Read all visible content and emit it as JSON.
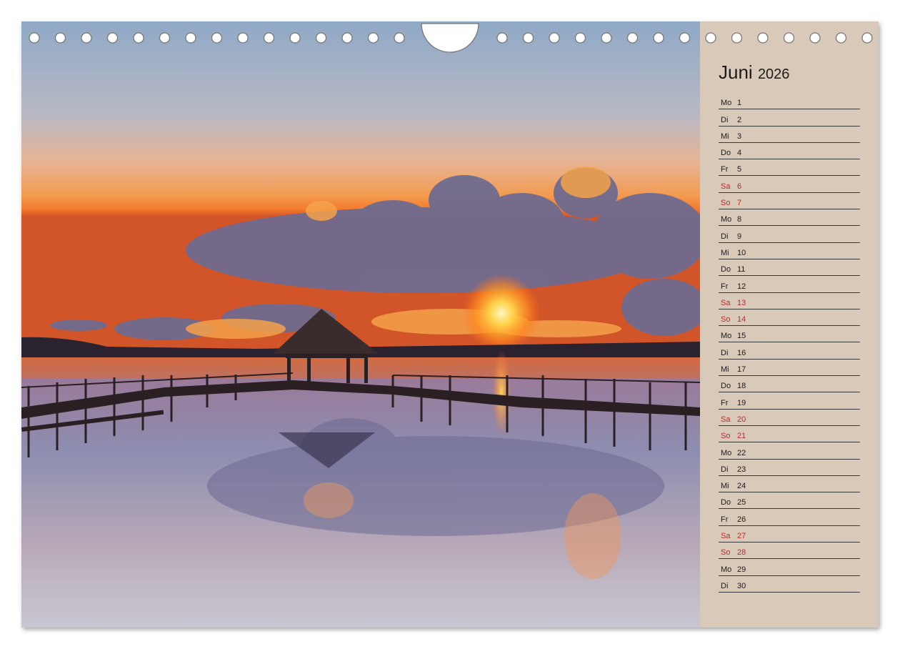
{
  "calendar": {
    "month": "Juni",
    "year": "2026",
    "days": [
      {
        "name": "Mo",
        "num": "1",
        "weekend": false
      },
      {
        "name": "Di",
        "num": "2",
        "weekend": false
      },
      {
        "name": "Mi",
        "num": "3",
        "weekend": false
      },
      {
        "name": "Do",
        "num": "4",
        "weekend": false
      },
      {
        "name": "Fr",
        "num": "5",
        "weekend": false
      },
      {
        "name": "Sa",
        "num": "6",
        "weekend": true
      },
      {
        "name": "So",
        "num": "7",
        "weekend": true
      },
      {
        "name": "Mo",
        "num": "8",
        "weekend": false
      },
      {
        "name": "Di",
        "num": "9",
        "weekend": false
      },
      {
        "name": "Mi",
        "num": "10",
        "weekend": false
      },
      {
        "name": "Do",
        "num": "11",
        "weekend": false
      },
      {
        "name": "Fr",
        "num": "12",
        "weekend": false
      },
      {
        "name": "Sa",
        "num": "13",
        "weekend": true
      },
      {
        "name": "So",
        "num": "14",
        "weekend": true
      },
      {
        "name": "Mo",
        "num": "15",
        "weekend": false
      },
      {
        "name": "Di",
        "num": "16",
        "weekend": false
      },
      {
        "name": "Mi",
        "num": "17",
        "weekend": false
      },
      {
        "name": "Do",
        "num": "18",
        "weekend": false
      },
      {
        "name": "Fr",
        "num": "19",
        "weekend": false
      },
      {
        "name": "Sa",
        "num": "20",
        "weekend": true
      },
      {
        "name": "So",
        "num": "21",
        "weekend": true
      },
      {
        "name": "Mo",
        "num": "22",
        "weekend": false
      },
      {
        "name": "Di",
        "num": "23",
        "weekend": false
      },
      {
        "name": "Mi",
        "num": "24",
        "weekend": false
      },
      {
        "name": "Do",
        "num": "25",
        "weekend": false
      },
      {
        "name": "Fr",
        "num": "26",
        "weekend": false
      },
      {
        "name": "Sa",
        "num": "27",
        "weekend": true
      },
      {
        "name": "So",
        "num": "28",
        "weekend": true
      },
      {
        "name": "Mo",
        "num": "29",
        "weekend": false
      },
      {
        "name": "Di",
        "num": "30",
        "weekend": false
      }
    ]
  },
  "colors": {
    "panel_bg": "#d9c9b9",
    "weekend_text": "#c0282c",
    "weekday_text": "#1b1b1b"
  },
  "photo": {
    "subject": "sunset-over-lake-with-pier-and-pavilion"
  }
}
